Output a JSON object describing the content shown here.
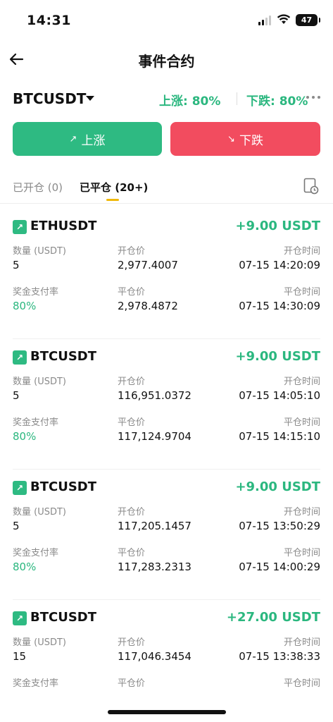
{
  "status_bar": {
    "time": "14:31",
    "battery": "47"
  },
  "nav": {
    "title": "事件合约"
  },
  "pair": {
    "name": "BTCUSDT",
    "rise_rate": "上涨: 80%",
    "fall_rate": "下跌: 80%"
  },
  "actions": {
    "up_label": "上涨",
    "down_label": "下跌",
    "up_arrow": "↗",
    "down_arrow": "↘"
  },
  "tabs": {
    "open": "已开仓 (0)",
    "closed": "已平仓 (20+)"
  },
  "labels": {
    "amount": "数量 (USDT)",
    "open_price": "开仓价",
    "open_time": "开仓时间",
    "payout": "奖金支付率",
    "close_price": "平仓价",
    "close_time": "平仓时间"
  },
  "positions": [
    {
      "symbol": "ETHUSDT",
      "pnl": "+9.00 USDT",
      "amount": "5",
      "open_price": "2,977.4007",
      "open_time": "07-15 14:20:09",
      "payout": "80%",
      "close_price": "2,978.4872",
      "close_time": "07-15 14:30:09"
    },
    {
      "symbol": "BTCUSDT",
      "pnl": "+9.00 USDT",
      "amount": "5",
      "open_price": "116,951.0372",
      "open_time": "07-15 14:05:10",
      "payout": "80%",
      "close_price": "117,124.9704",
      "close_time": "07-15 14:15:10"
    },
    {
      "symbol": "BTCUSDT",
      "pnl": "+9.00 USDT",
      "amount": "5",
      "open_price": "117,205.1457",
      "open_time": "07-15 13:50:29",
      "payout": "80%",
      "close_price": "117,283.2313",
      "close_time": "07-15 14:00:29"
    },
    {
      "symbol": "BTCUSDT",
      "pnl": "+27.00 USDT",
      "amount": "15",
      "open_price": "117,046.3454",
      "open_time": "07-15 13:38:33",
      "payout": "",
      "close_price": "",
      "close_time": ""
    }
  ],
  "colors": {
    "green": "#2eba82",
    "red": "#f24c5f",
    "accent": "#f0b90b"
  }
}
